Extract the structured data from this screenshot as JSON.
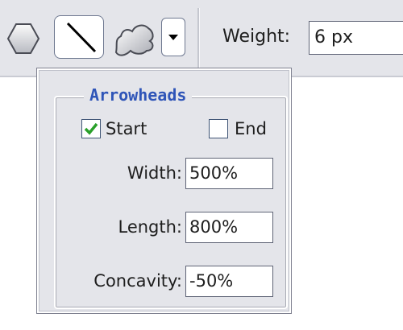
{
  "toolbar": {
    "tools": {
      "polygon_icon": "polygon-shape-icon",
      "line_icon": "line-tool-icon",
      "custom_shape_icon": "custom-shape-icon",
      "dropdown_icon": "chevron-down-icon"
    },
    "weight_label": "Weight:",
    "weight_value": "6 px"
  },
  "popup": {
    "group_title": "Arrowheads",
    "start": {
      "label": "Start",
      "checked": true
    },
    "end": {
      "label": "End",
      "checked": false
    },
    "fields": {
      "width_label": "Width:",
      "width_value": "500%",
      "length_label": "Length:",
      "length_value": "800%",
      "concavity_label": "Concavity:",
      "concavity_value": "-50%"
    }
  },
  "colors": {
    "toolbar_bg": "#e4e5ea",
    "group_title": "#2f55b8",
    "checkmark": "#2aa02a"
  }
}
